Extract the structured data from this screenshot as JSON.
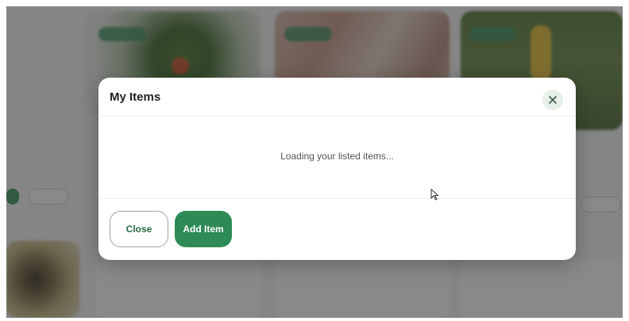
{
  "modal": {
    "title": "My Items",
    "loading_text": "Loading your listed items...",
    "close_icon": "close-icon",
    "buttons": {
      "close_label": "Close",
      "add_item_label": "Add Item"
    }
  },
  "colors": {
    "accent": "#2e8b57",
    "overlay": "rgba(40,40,40,0.55)"
  }
}
